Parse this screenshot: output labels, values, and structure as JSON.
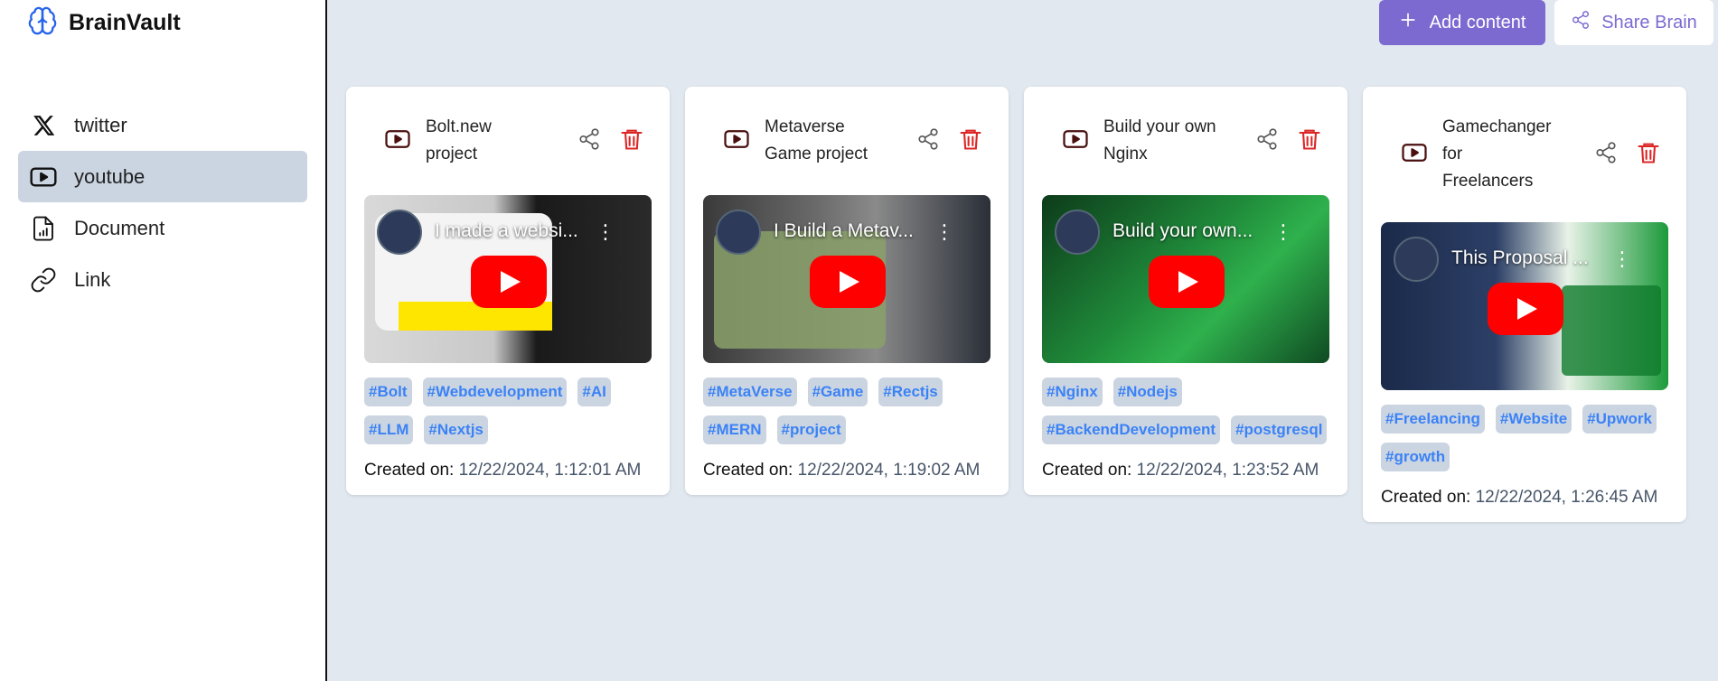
{
  "brand": {
    "title": "BrainVault"
  },
  "sidebar": {
    "items": [
      {
        "label": "twitter",
        "icon": "x-icon",
        "active": false
      },
      {
        "label": "youtube",
        "icon": "youtube-icon",
        "active": true
      },
      {
        "label": "Document",
        "icon": "document-icon",
        "active": false
      },
      {
        "label": "Link",
        "icon": "link-icon",
        "active": false
      }
    ]
  },
  "header": {
    "add_label": "Add content",
    "share_label": "Share Brain"
  },
  "cards": [
    {
      "title": "Bolt.new project",
      "type_icon": "youtube-icon",
      "video_title": "I made a websi...",
      "tags": [
        "#Bolt",
        "#Webdevelopment",
        "#AI",
        "#LLM",
        "#Nextjs"
      ],
      "created_label": "Created on:",
      "created_date": "12/22/2024, 1:12:01 AM"
    },
    {
      "title": "Metaverse Game project",
      "type_icon": "youtube-icon",
      "video_title": "I Build a Metav...",
      "tags": [
        "#MetaVerse",
        "#Game",
        "#Rectjs",
        "#MERN",
        "#project"
      ],
      "created_label": "Created on:",
      "created_date": "12/22/2024, 1:19:02 AM"
    },
    {
      "title": "Build your own Nginx",
      "type_icon": "youtube-icon",
      "video_title": "Build your own...",
      "tags": [
        "#Nginx",
        "#Nodejs",
        "#BackendDevelopment",
        "#postgresql"
      ],
      "created_label": "Created on:",
      "created_date": "12/22/2024, 1:23:52 AM"
    },
    {
      "title": "Gamechanger for Freelancers",
      "type_icon": "youtube-icon",
      "video_title": "This Proposal ...",
      "tags": [
        "#Freelancing",
        "#Website",
        "#Upwork",
        "#growth"
      ],
      "created_label": "Created on:",
      "created_date": "12/22/2024, 1:26:45 AM"
    }
  ],
  "colors": {
    "accent": "#7c6ad1",
    "tag_text": "#3b82f6",
    "tag_bg": "#cbd5e1",
    "delete": "#dc2626",
    "page_bg": "#e2e8f0"
  }
}
